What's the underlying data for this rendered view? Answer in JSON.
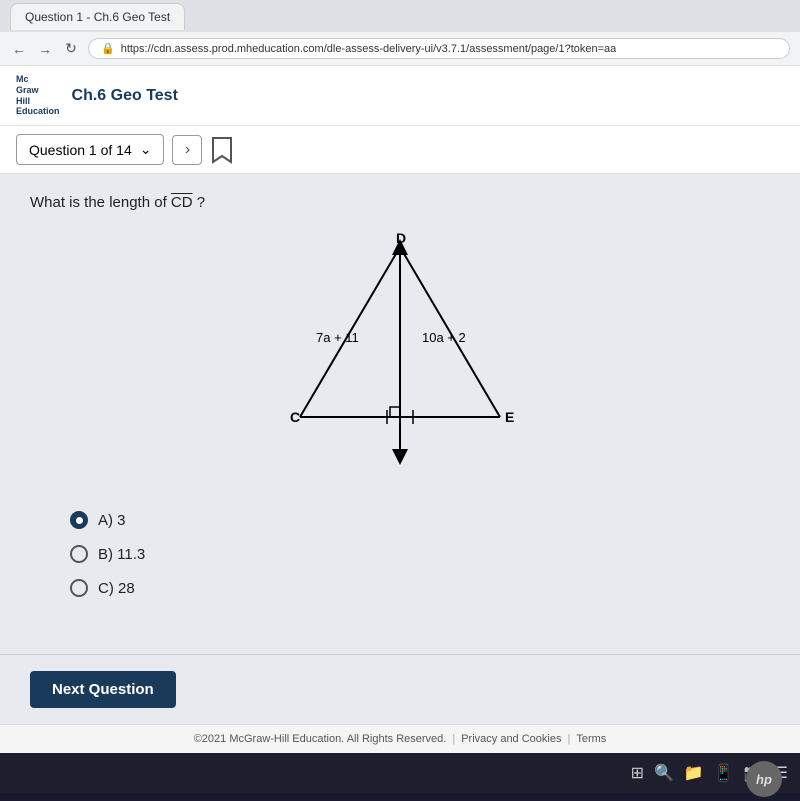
{
  "browser": {
    "url": "https://cdn.assess.prod.mheducation.com/dle-assess-delivery-ui/v3.7.1/assessment/page/1?token=aa",
    "tab_title": "Question 1 - Ch.6 Geo Test"
  },
  "header": {
    "logo_line1": "Mc",
    "logo_line2": "Graw",
    "logo_line3": "Hill",
    "logo_line4": "Education",
    "title": "Ch.6 Geo Test"
  },
  "navigation": {
    "question_label": "Question 1 of 14",
    "dropdown_arrow": "∨",
    "next_arrow": "›"
  },
  "question": {
    "text": "What is the length of ",
    "segment": "CD",
    "text_suffix": " ?",
    "diagram": {
      "left_label": "7a + 11",
      "right_label": "10a + 2",
      "top_vertex": "D",
      "bottom_left": "C",
      "bottom_right": "E"
    },
    "answers": [
      {
        "id": "A",
        "label": "A) 3",
        "selected": true
      },
      {
        "id": "B",
        "label": "B) 11.3",
        "selected": false
      },
      {
        "id": "C",
        "label": "C) 28",
        "selected": false
      }
    ]
  },
  "footer": {
    "next_button": "Next Question",
    "copyright": "©2021 McGraw-Hill Education. All Rights Reserved.",
    "privacy_link": "Privacy and Cookies",
    "terms_link": "Terms"
  }
}
